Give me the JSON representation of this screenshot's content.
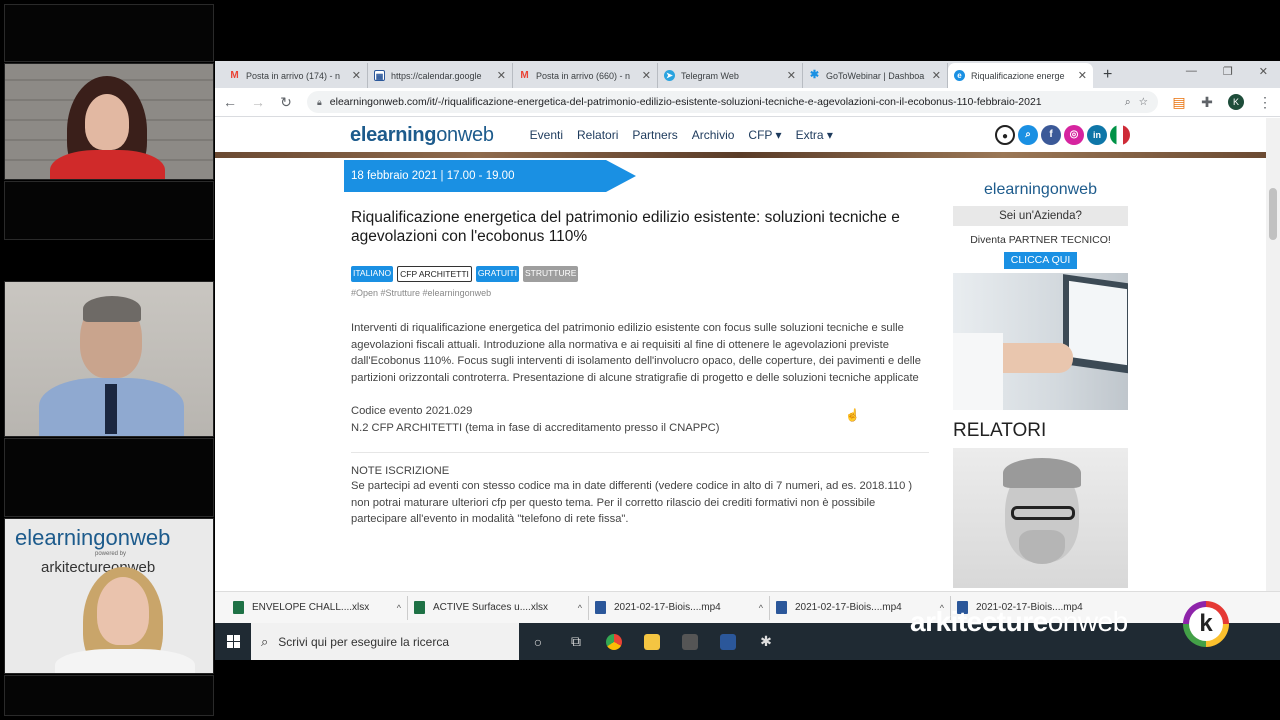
{
  "colors": {
    "accent": "#1a90e3",
    "brand": "#1d5b8c",
    "taskbar": "#1f2a33"
  },
  "participants": [
    {
      "name": "webcam-participant-1"
    },
    {
      "name": "webcam-participant-2"
    },
    {
      "name": "webcam-participant-3",
      "overlay_logo": "elearningonweb",
      "overlay_powered": "powered by",
      "overlay_sub": "arkitectureonweb"
    }
  ],
  "browser": {
    "tabs": [
      {
        "label": "Posta in arrivo (174) - n",
        "icon": "gmail-icon",
        "active": false
      },
      {
        "label": "https://calendar.google",
        "icon": "calendar-icon",
        "active": false
      },
      {
        "label": "Posta in arrivo (660) - n",
        "icon": "gmail-icon",
        "active": false
      },
      {
        "label": "Telegram Web",
        "icon": "telegram-icon",
        "active": false
      },
      {
        "label": "GoToWebinar | Dashboa",
        "icon": "gotowebinar-icon",
        "active": false
      },
      {
        "label": "Riqualificazione energe",
        "icon": "site-icon",
        "active": true
      }
    ],
    "url": "elearningonweb.com/it/-/riqualificazione-energetica-del-patrimonio-edilizio-esistente-soluzioni-tecniche-e-agevolazioni-con-il-ecobonus-110-febbraio-2021",
    "profile_initial": "K"
  },
  "site": {
    "logo_bold": "elearning",
    "logo_regular": "onweb",
    "menu": [
      "Eventi",
      "Relatori",
      "Partners",
      "Archivio",
      "CFP ▾",
      "Extra ▾"
    ],
    "social": [
      "user-icon",
      "search-icon",
      "facebook-icon",
      "instagram-icon",
      "linkedin-icon",
      "italy-flag-icon"
    ]
  },
  "event": {
    "date": "18 febbraio 2021 | 17.00 - 19.00",
    "title": "Riqualificazione energetica del patrimonio edilizio esistente: soluzioni tecniche e agevolazioni con l'ecobonus 110%",
    "tags": [
      {
        "label": "ITALIANO",
        "style": "blue"
      },
      {
        "label": "CFP ARCHITETTI",
        "style": "outline"
      },
      {
        "label": "GRATUITI",
        "style": "blue"
      },
      {
        "label": "STRUTTURE",
        "style": "gray"
      }
    ],
    "hashtags": "#Open #Strutture #elearningonweb",
    "description": "Interventi di riqualificazione energetica del patrimonio edilizio esistente con focus sulle soluzioni tecniche e sulle agevolazioni fiscali attuali. Introduzione alla normativa e ai requisiti al fine di ottenere le agevolazioni previste dall'Ecobonus 110%. Focus sugli interventi di isolamento dell'involucro opaco, delle coperture, dei pavimenti e delle partizioni orizzontali controterra. Presentazione di alcune stratigrafie di progetto e delle soluzioni tecniche applicate",
    "code": "Codice evento 2021.029",
    "cfp": "N.2 CFP ARCHITETTI (tema in fase di accreditamento presso il CNAPPC)",
    "note_title": "NOTE ISCRIZIONE",
    "note_text": "Se partecipi ad eventi con stesso codice ma in date differenti (vedere codice in alto di 7 numeri, ad es. 2018.110 ) non potrai maturare ulteriori cfp per questo tema. Per il corretto rilascio dei crediti formativi non è possibile partecipare all'evento in modalità \"telefono di rete fissa\"."
  },
  "sidebar": {
    "logo": "elearningonweb",
    "company_q": "Sei un'Azienda?",
    "partner": "Diventa PARTNER TECNICO!",
    "cta": "CLICCA QUI",
    "relatori": "RELATORI"
  },
  "downloads": [
    {
      "name": "ENVELOPE CHALL....xlsx",
      "color": "#1e7145"
    },
    {
      "name": "ACTIVE Surfaces u....xlsx",
      "color": "#1e7145"
    },
    {
      "name": "2021-02-17-Biois....mp4",
      "color": "#2b579a"
    },
    {
      "name": "2021-02-17-Biois....mp4",
      "color": "#2b579a"
    },
    {
      "name": "2021-02-17-Biois....mp4",
      "color": "#2b579a"
    }
  ],
  "taskbar": {
    "search_placeholder": "Scrivi qui per eseguire la ricerca"
  },
  "watermark": {
    "bold": "arkitecture",
    "regular": "onweb",
    "logo_letter": "k"
  }
}
